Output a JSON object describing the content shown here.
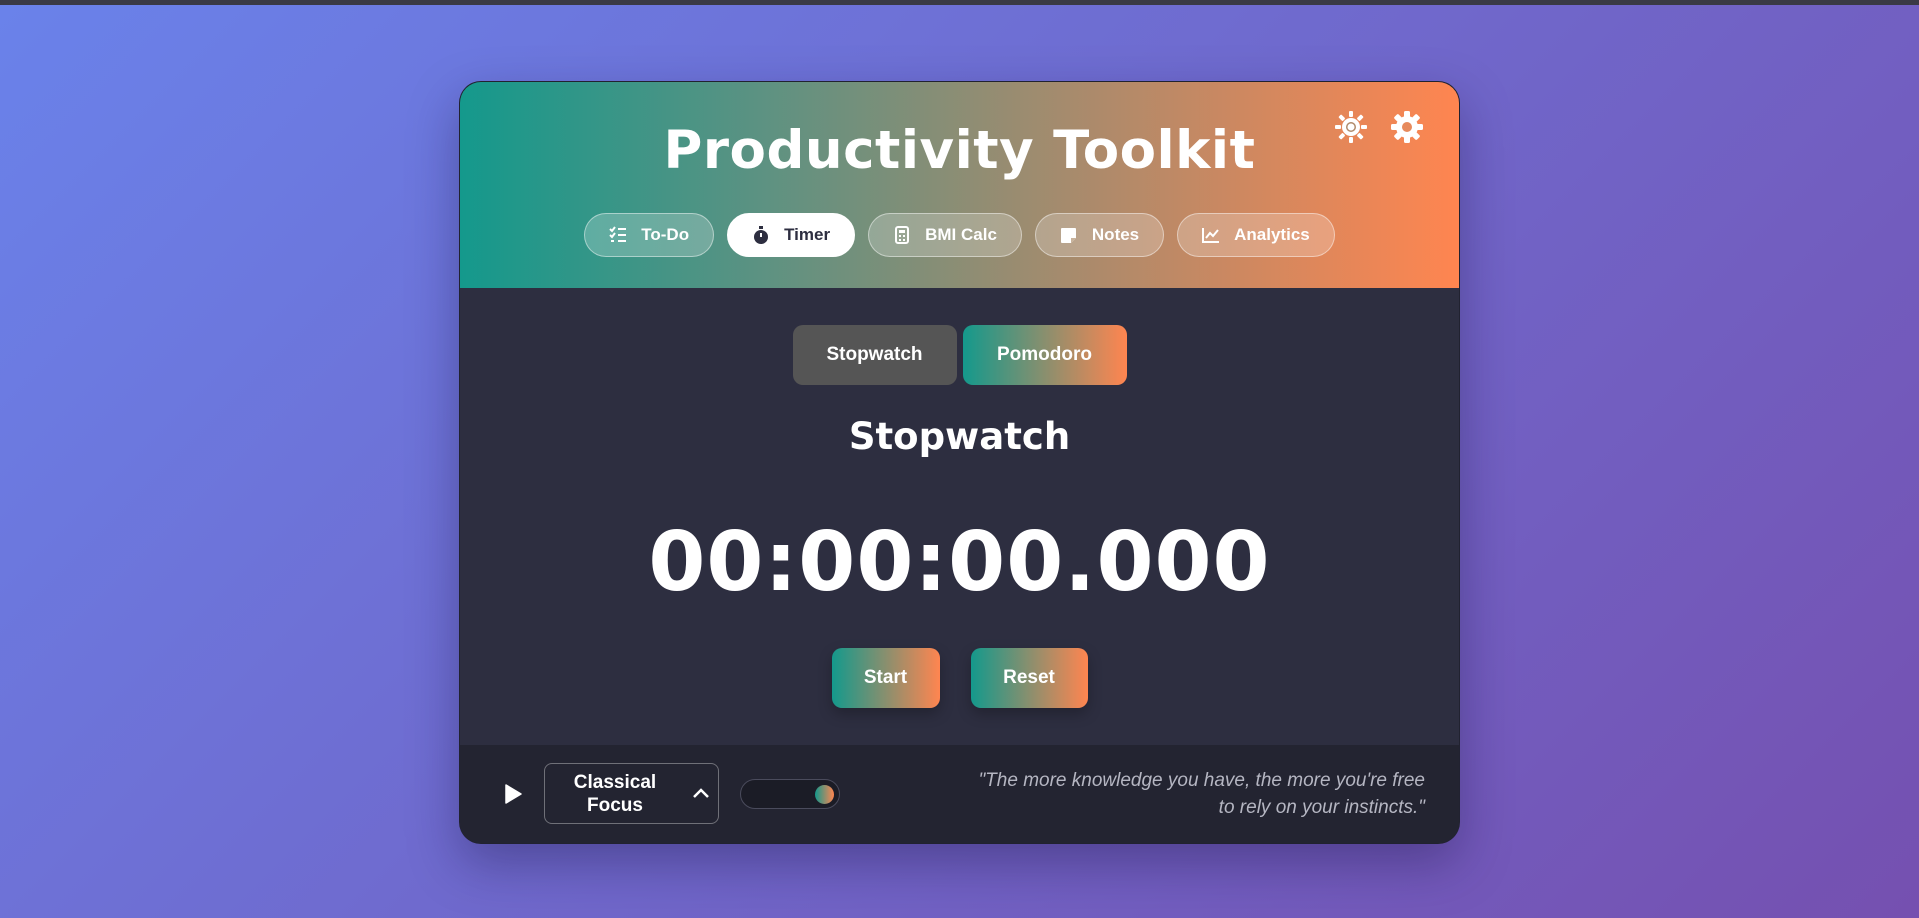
{
  "app": {
    "title": "Productivity Toolkit"
  },
  "header": {
    "icons": [
      "sun-icon",
      "gear-icon"
    ],
    "tabs": [
      {
        "label": "To-Do",
        "icon": "checklist-icon",
        "active": false
      },
      {
        "label": "Timer",
        "icon": "stopwatch-icon",
        "active": true
      },
      {
        "label": "BMI Calc",
        "icon": "calculator-icon",
        "active": false
      },
      {
        "label": "Notes",
        "icon": "sticky-note-icon",
        "active": false
      },
      {
        "label": "Analytics",
        "icon": "chart-line-icon",
        "active": false
      }
    ]
  },
  "timer": {
    "modes": [
      {
        "label": "Stopwatch",
        "active": true
      },
      {
        "label": "Pomodoro",
        "active": false
      }
    ],
    "section_title": "Stopwatch",
    "display": "00:00:00.000",
    "start_label": "Start",
    "reset_label": "Reset"
  },
  "footer": {
    "music_track": "Classical Focus",
    "quote": "\"The more knowledge you have, the more you're free to rely on your instincts.\""
  },
  "colors": {
    "accent_start": "#14998c",
    "accent_end": "#ff8550",
    "card_bg": "#2d2e40",
    "footer_bg": "#232431"
  }
}
